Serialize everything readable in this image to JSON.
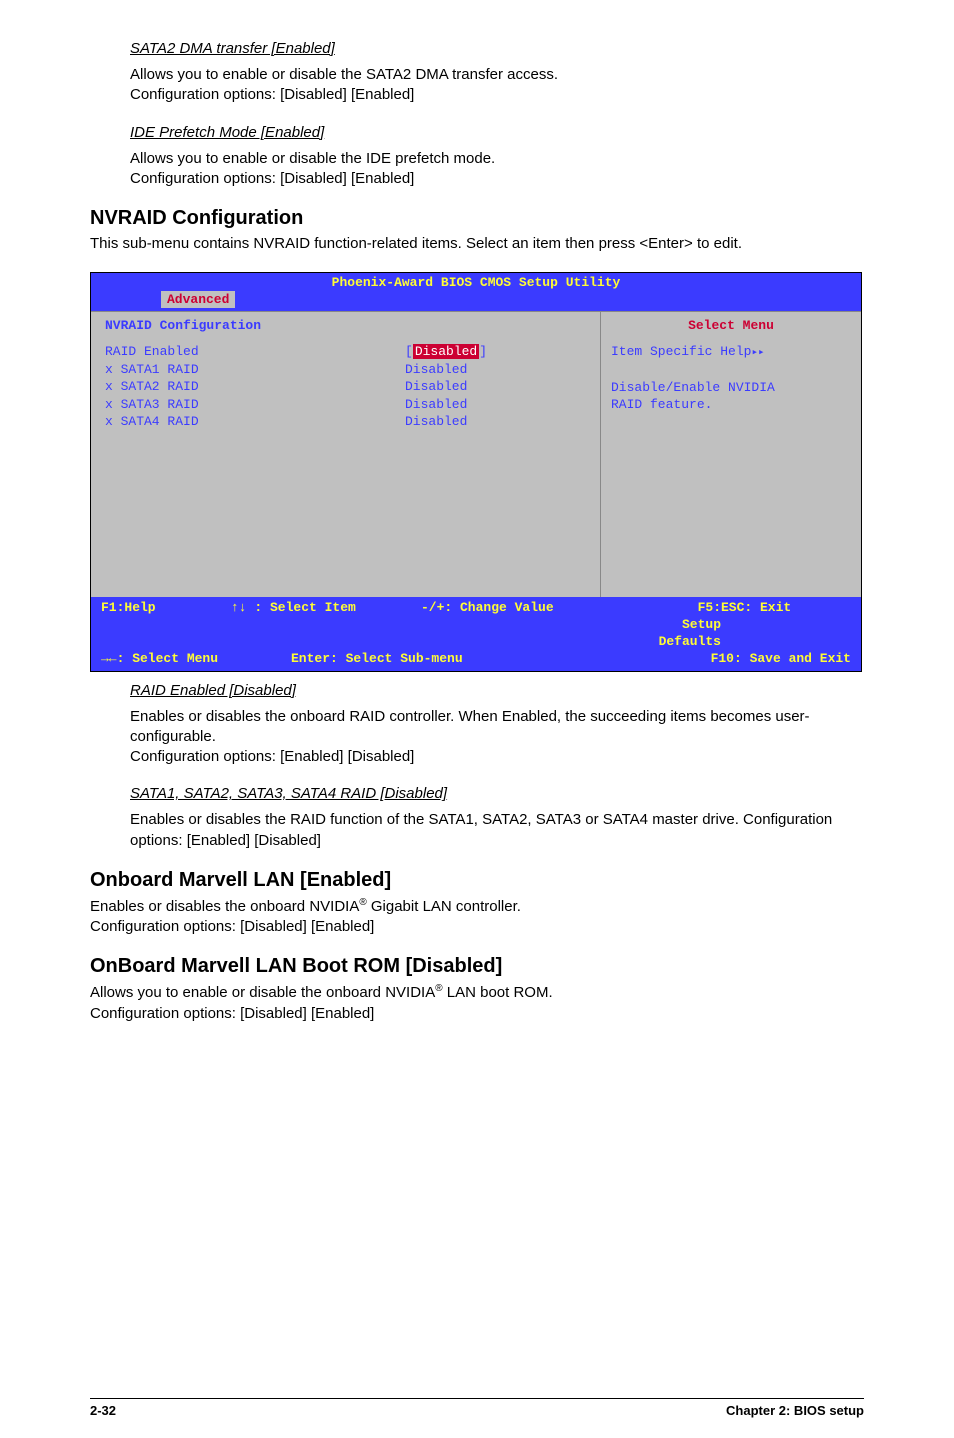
{
  "s1": {
    "title": "SATA2 DMA transfer [Enabled]",
    "p1": "Allows you to enable or disable the SATA2 DMA transfer access.",
    "p2": "Configuration options: [Disabled] [Enabled]"
  },
  "s2": {
    "title": "IDE Prefetch Mode [Enabled]",
    "p1": "Allows you to enable or disable the IDE prefetch mode.",
    "p2": "Configuration options: [Disabled] [Enabled]"
  },
  "nvraid": {
    "heading": "NVRAID Configuration",
    "intro": "This sub-menu contains NVRAID function-related items. Select an item then press <Enter> to edit."
  },
  "bios": {
    "title": "Phoenix-Award BIOS CMOS Setup Utility",
    "tab": "Advanced",
    "conf_title": "NVRAID Configuration",
    "rows": [
      {
        "label": "  RAID Enabled",
        "value": "Disabled",
        "selected": true
      },
      {
        "label": "x SATA1 RAID",
        "value": "Disabled"
      },
      {
        "label": "x SATA2 RAID",
        "value": "Disabled"
      },
      {
        "label": "x SATA3 RAID",
        "value": "Disabled"
      },
      {
        "label": "x SATA4 RAID",
        "value": "Disabled"
      }
    ],
    "select_menu": "Select Menu",
    "help_title": "Item Specific Help",
    "help1": "Disable/Enable NVIDIA",
    "help2": "RAID feature.",
    "footer": {
      "c1a": "F1:Help",
      "c2a": "↑↓ : Select Item",
      "c3a": "-/+: Change Value",
      "c4a": "F5: Setup Defaults",
      "c1b": "ESC: Exit",
      "c2b": "→←: Select Menu",
      "c3b": "Enter: Select Sub-menu",
      "c4b": "F10: Save and Exit"
    }
  },
  "raid": {
    "title": "RAID Enabled [Disabled]",
    "p1": "Enables or disables the onboard RAID controller. When Enabled, the succeeding items becomes user-configurable.",
    "p2": "Configuration options: [Enabled] [Disabled]"
  },
  "sata": {
    "title": "SATA1, SATA2, SATA3, SATA4 RAID [Disabled]",
    "p1": "Enables or disables the RAID function of the SATA1, SATA2, SATA3 or SATA4 master drive. Configuration options: [Enabled] [Disabled]"
  },
  "marvell_lan": {
    "heading": "Onboard Marvell LAN [Enabled]",
    "p1_pre": "Enables or disables the onboard NVIDIA",
    "p1_post": " Gigabit LAN controller.",
    "p2": "Configuration options: [Disabled] [Enabled]"
  },
  "marvell_rom": {
    "heading": "OnBoard Marvell LAN Boot ROM [Disabled]",
    "p1_pre": "Allows you to enable or disable the onboard NVIDIA",
    "p1_post": " LAN boot ROM.",
    "p2": "Configuration options: [Disabled] [Enabled]"
  },
  "footer": {
    "left": "2-32",
    "right": "Chapter 2: BIOS setup"
  }
}
